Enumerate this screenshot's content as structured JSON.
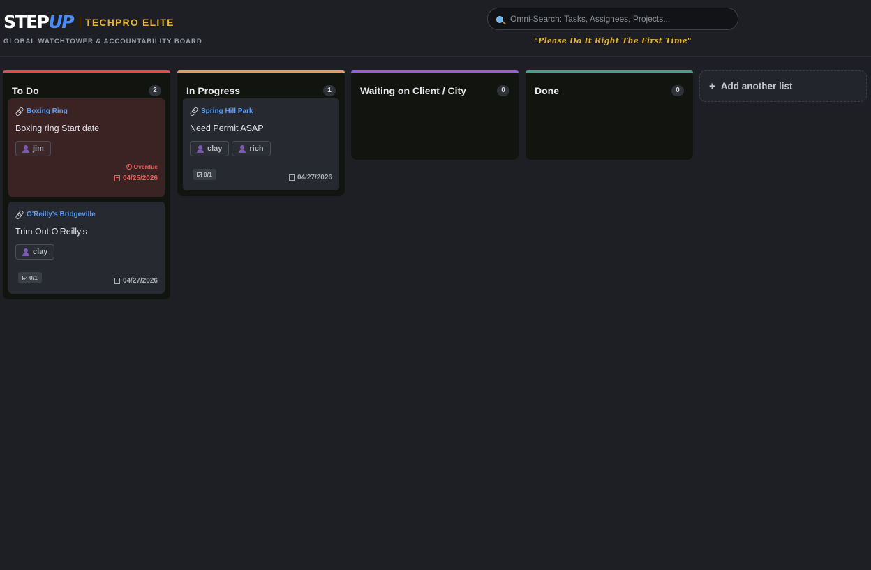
{
  "header": {
    "logo_step": "STEP",
    "logo_up": "UP",
    "brand_sub": "TECHPRO ELITE",
    "tagline": "GLOBAL WATCHTOWER & ACCOUNTABILITY BOARD",
    "search_placeholder": "Omni-Search: Tasks, Assignees, Projects...",
    "motto": "\"Please Do It Right The First Time\""
  },
  "colors": {
    "todo": "#e5484d",
    "in_progress": "#f0994a",
    "waiting": "#9b59e8",
    "done": "#3aa58f",
    "link": "#5b9bf2",
    "overdue": "#f05a5a",
    "brand_gold": "#e3b53a"
  },
  "columns": [
    {
      "title": "To Do",
      "count": "2",
      "cards": [
        {
          "project": "Boxing Ring",
          "title": "Boxing ring Start date",
          "assignees": [
            "jim"
          ],
          "overdue_label": "Overdue",
          "due": "04/25/2026"
        },
        {
          "project": "O'Reilly's Bridgeville",
          "title": "Trim Out O'Reilly's",
          "assignees": [
            "clay"
          ],
          "checklist": "0/1",
          "due": "04/27/2026"
        }
      ]
    },
    {
      "title": "In Progress",
      "count": "1",
      "cards": [
        {
          "project": "Spring Hill Park",
          "title": "Need Permit ASAP",
          "assignees": [
            "clay",
            "rich"
          ],
          "checklist": "0/1",
          "due": "04/27/2026"
        }
      ]
    },
    {
      "title": "Waiting on Client / City",
      "count": "0",
      "cards": []
    },
    {
      "title": "Done",
      "count": "0",
      "cards": []
    }
  ],
  "add_list_label": "Add another list"
}
